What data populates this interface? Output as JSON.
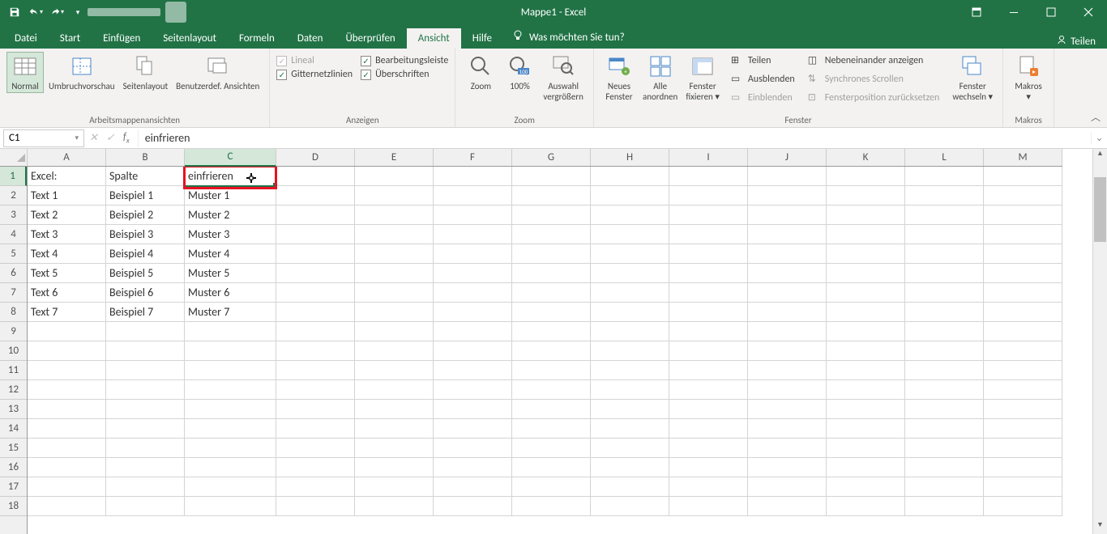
{
  "titlebar": {
    "title": "Mappe1 - Excel"
  },
  "tabs": {
    "items": [
      "Datei",
      "Start",
      "Einfügen",
      "Seitenlayout",
      "Formeln",
      "Daten",
      "Überprüfen",
      "Ansicht",
      "Hilfe"
    ],
    "active": 7,
    "tellme": "Was möchten Sie tun?",
    "share": "Teilen"
  },
  "ribbon": {
    "views": {
      "normal": "Normal",
      "umbruch": "Umbruchvorschau",
      "seiten": "Seitenlayout",
      "benutzer": "Benutzerdef. Ansichten",
      "label": "Arbeitsmappenansichten"
    },
    "anzeigen": {
      "lineal": "Lineal",
      "gitternetz": "Gitternetzlinien",
      "bearbeitungs": "Bearbeitungsleiste",
      "ueberschriften": "Überschriften",
      "label": "Anzeigen"
    },
    "zoom": {
      "zoom": "Zoom",
      "hundert": "100%",
      "auswahl_l1": "Auswahl",
      "auswahl_l2": "vergrößern",
      "label": "Zoom"
    },
    "fenster": {
      "neues_l1": "Neues",
      "neues_l2": "Fenster",
      "alle_l1": "Alle",
      "alle_l2": "anordnen",
      "fix_l1": "Fenster",
      "fix_l2": "fixieren",
      "teilen": "Teilen",
      "ausblenden": "Ausblenden",
      "einblenden": "Einblenden",
      "neben": "Nebeneinander anzeigen",
      "sync": "Synchrones Scrollen",
      "pos": "Fensterposition zurücksetzen",
      "wechseln_l1": "Fenster",
      "wechseln_l2": "wechseln",
      "label": "Fenster"
    },
    "makros": {
      "makros": "Makros",
      "label": "Makros"
    }
  },
  "fbar": {
    "name": "C1",
    "formula": "einfrieren"
  },
  "columns": [
    "A",
    "B",
    "C",
    "D",
    "E",
    "F",
    "G",
    "H",
    "I",
    "J",
    "K",
    "L",
    "M"
  ],
  "rowCount": 18,
  "selectedCol": 2,
  "selectedRow": 0,
  "data": {
    "rows": [
      {
        "A": "Excel:",
        "B": "Spalte",
        "C": "einfrieren"
      },
      {
        "A": "Text 1",
        "B": "Beispiel 1",
        "C": "Muster 1"
      },
      {
        "A": "Text 2",
        "B": "Beispiel 2",
        "C": "Muster 2"
      },
      {
        "A": "Text 3",
        "B": "Beispiel 3",
        "C": "Muster 3"
      },
      {
        "A": "Text 4",
        "B": "Beispiel 4",
        "C": "Muster 4"
      },
      {
        "A": "Text 5",
        "B": "Beispiel 5",
        "C": "Muster 5"
      },
      {
        "A": "Text 6",
        "B": "Beispiel 6",
        "C": "Muster 6"
      },
      {
        "A": "Text 7",
        "B": "Beispiel 7",
        "C": "Muster 7"
      }
    ]
  }
}
